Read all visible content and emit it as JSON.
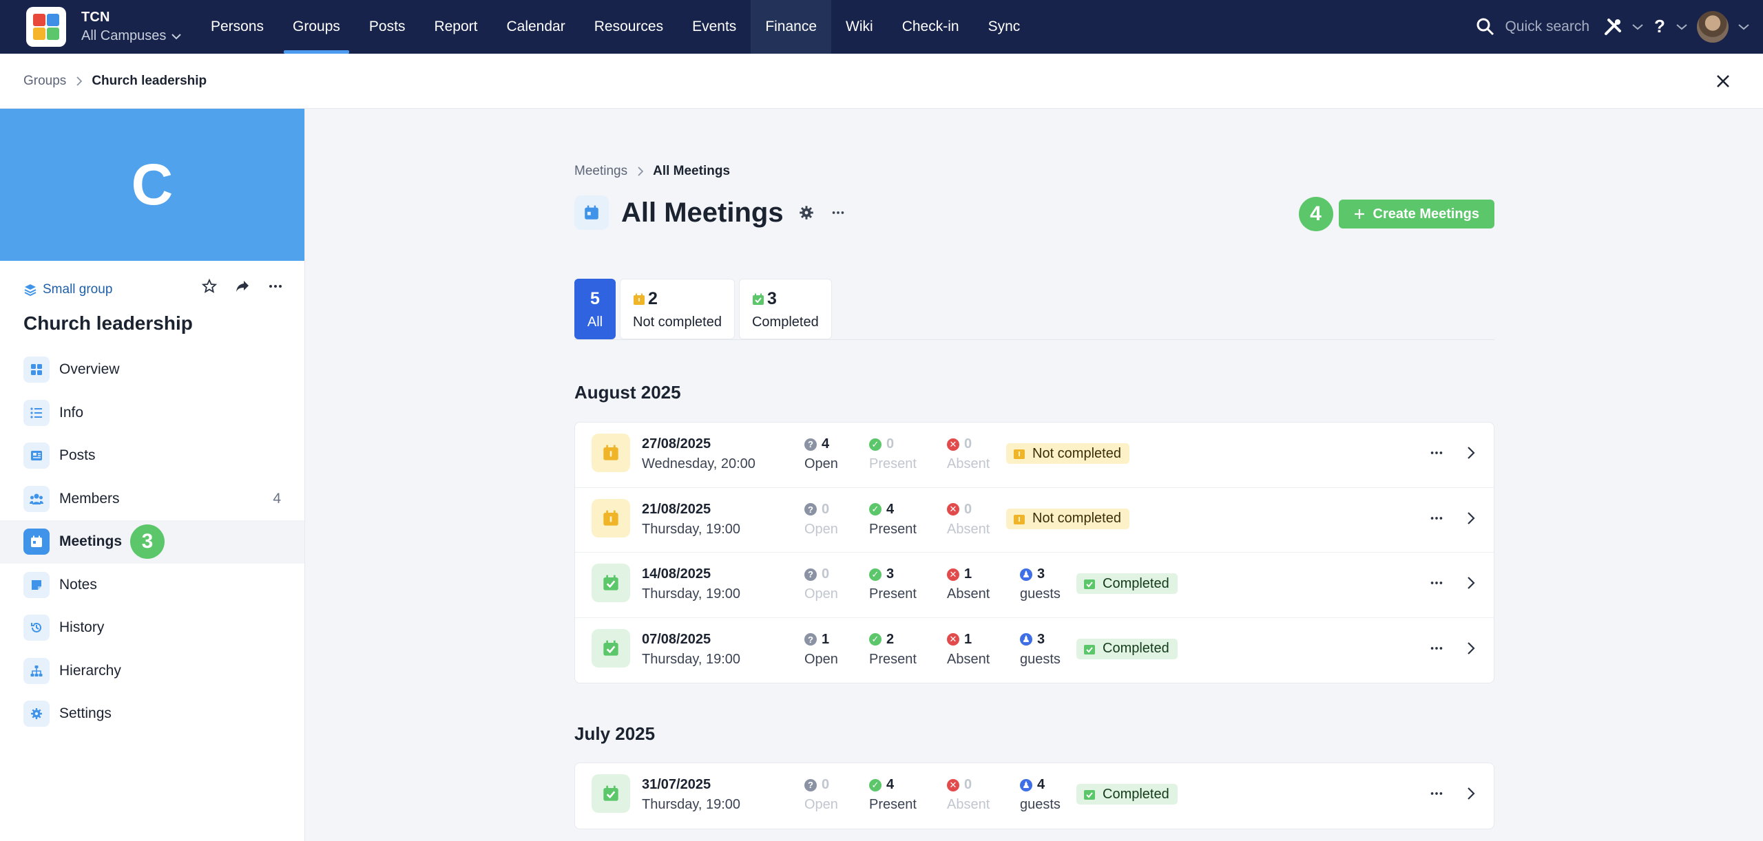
{
  "app": {
    "brand": "TCN",
    "campus": "All Campuses",
    "nav": [
      "Persons",
      "Groups",
      "Posts",
      "Report",
      "Calendar",
      "Resources",
      "Events",
      "Finance",
      "Wiki",
      "Check-in",
      "Sync"
    ],
    "active_nav": "Groups",
    "quick_search": "Quick search"
  },
  "breadcrumb": {
    "parent": "Groups",
    "current": "Church leadership"
  },
  "group": {
    "initial": "C",
    "type": "Small group",
    "name": "Church leadership",
    "menu": [
      {
        "label": "Overview",
        "icon": "grid-icon"
      },
      {
        "label": "Info",
        "icon": "list-icon"
      },
      {
        "label": "Posts",
        "icon": "newspaper-icon"
      },
      {
        "label": "Members",
        "icon": "people-icon",
        "count": "4"
      },
      {
        "label": "Meetings",
        "icon": "calendar-icon",
        "active": true
      },
      {
        "label": "Notes",
        "icon": "note-icon"
      },
      {
        "label": "History",
        "icon": "history-icon"
      },
      {
        "label": "Hierarchy",
        "icon": "hierarchy-icon"
      },
      {
        "label": "Settings",
        "icon": "gear-icon"
      }
    ],
    "meetings_step": "3"
  },
  "main": {
    "breadcrumb": {
      "parent": "Meetings",
      "current": "All Meetings"
    },
    "title": "All Meetings",
    "create_step": "4",
    "create_label": "Create Meetings",
    "tabs": [
      {
        "count": "5",
        "label": "All"
      },
      {
        "count": "2",
        "label": "Not completed"
      },
      {
        "count": "3",
        "label": "Completed"
      }
    ],
    "months": [
      {
        "name": "August 2025",
        "meetings": [
          {
            "date": "27/08/2025",
            "time": "Wednesday, 20:00",
            "open": "4",
            "present": "0",
            "absent": "0",
            "guests": "",
            "status": "Not completed"
          },
          {
            "date": "21/08/2025",
            "time": "Thursday, 19:00",
            "open": "0",
            "present": "4",
            "absent": "0",
            "guests": "",
            "status": "Not completed"
          },
          {
            "date": "14/08/2025",
            "time": "Thursday, 19:00",
            "open": "0",
            "present": "3",
            "absent": "1",
            "guests": "3",
            "status": "Completed"
          },
          {
            "date": "07/08/2025",
            "time": "Thursday, 19:00",
            "open": "1",
            "present": "2",
            "absent": "1",
            "guests": "3",
            "status": "Completed"
          }
        ]
      },
      {
        "name": "July 2025",
        "meetings": [
          {
            "date": "31/07/2025",
            "time": "Thursday, 19:00",
            "open": "0",
            "present": "4",
            "absent": "0",
            "guests": "4",
            "status": "Completed"
          }
        ]
      }
    ],
    "labels": {
      "open": "Open",
      "present": "Present",
      "absent": "Absent",
      "guests": "guests"
    }
  },
  "colors": {
    "nav_bg": "#17234a",
    "accent_blue": "#2f63e0",
    "success": "#5cc66a",
    "hero": "#4fa2eb",
    "pending": "#fdf1c7"
  }
}
